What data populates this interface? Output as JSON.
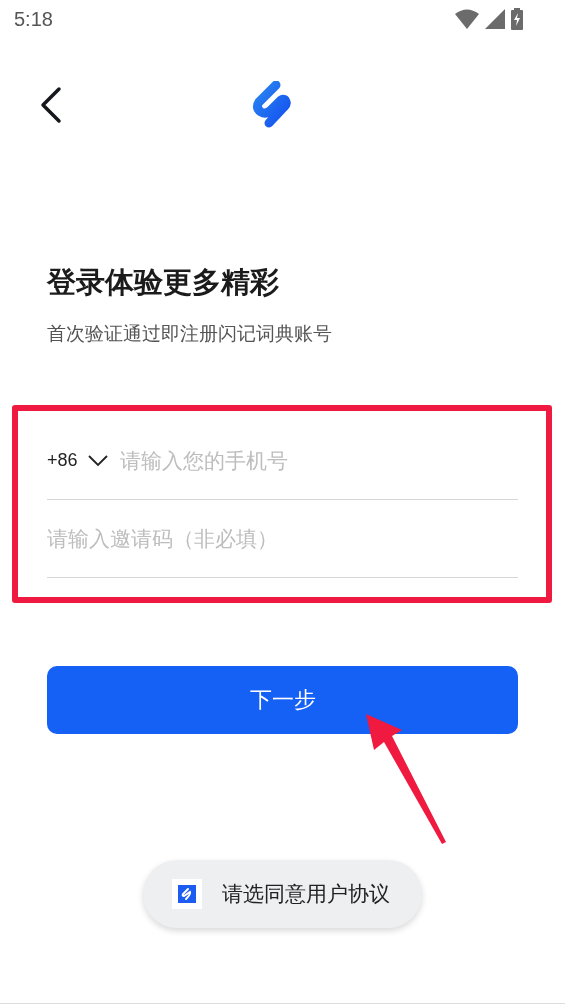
{
  "status_bar": {
    "time": "5:18"
  },
  "title": "登录体验更多精彩",
  "subtitle": "首次验证通过即注册闪记词典账号",
  "form": {
    "country_code": "+86",
    "phone": {
      "placeholder": "请输入您的手机号"
    },
    "invite": {
      "placeholder": "请输入邀请码（非必填）"
    }
  },
  "next_button": "下一步",
  "toast": {
    "text": "请选同意用户协议"
  },
  "annotations": {
    "highlight_box": true,
    "arrow": true
  }
}
